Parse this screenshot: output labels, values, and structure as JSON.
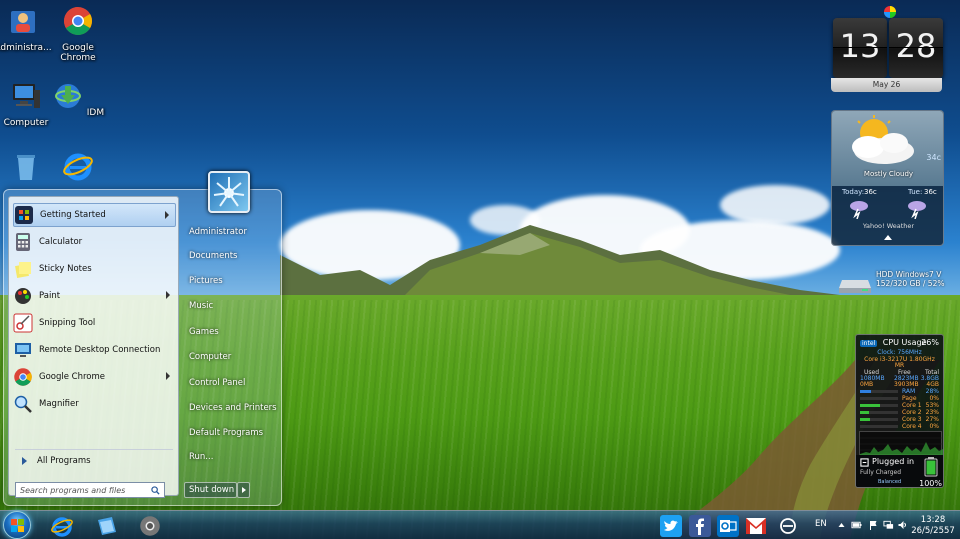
{
  "desktop": {
    "icons": [
      {
        "label": "Administra...",
        "icon": "user-folder-icon"
      },
      {
        "label": "Google Chrome",
        "icon": "chrome-icon"
      },
      {
        "label": "Computer",
        "icon": "computer-icon"
      },
      {
        "label": "IDM",
        "icon": "idm-icon"
      },
      {
        "label": "",
        "icon": "recycle-bin-icon"
      },
      {
        "label": "",
        "icon": "internet-explorer-icon"
      }
    ]
  },
  "start_menu": {
    "programs": [
      {
        "label": "Getting Started",
        "has_submenu": true
      },
      {
        "label": "Calculator",
        "has_submenu": false
      },
      {
        "label": "Sticky Notes",
        "has_submenu": false
      },
      {
        "label": "Paint",
        "has_submenu": true
      },
      {
        "label": "Snipping Tool",
        "has_submenu": false
      },
      {
        "label": "Remote Desktop Connection",
        "has_submenu": false
      },
      {
        "label": "Google Chrome",
        "has_submenu": true
      },
      {
        "label": "Magnifier",
        "has_submenu": false
      }
    ],
    "all_programs": "All Programs",
    "search_placeholder": "Search programs and files",
    "right_items": [
      "Administrator",
      "Documents",
      "Pictures",
      "Music",
      "Games",
      "Computer",
      "Control Panel",
      "Devices and Printers",
      "Default Programs",
      "Run..."
    ],
    "shutdown_label": "Shut down"
  },
  "clock": {
    "hours": "13",
    "minutes": "28",
    "date": "May 26"
  },
  "weather": {
    "current_temp": "34c",
    "condition": "Mostly Cloudy",
    "forecast": [
      {
        "day": "Today:",
        "temp": "36c"
      },
      {
        "day": "Tue:",
        "temp": "36c"
      }
    ],
    "provider": "Yahoo! Weather"
  },
  "drive": {
    "line1": "HDD Windows7 V",
    "line2": "152/320 GB / 52%"
  },
  "cpu": {
    "title": "CPU Usage",
    "usage": "26%",
    "clock": "Clock: 756MHz",
    "model": "Core i3-3217U 1.80GHz",
    "model2": "MR",
    "headers": [
      "Used",
      "Free",
      "Total"
    ],
    "ram_used": "1080MB",
    "ram_free": "2823MB",
    "ram_total": "3.8GB",
    "page_used": "0MB",
    "page_free": "3903MB",
    "page_total": "4GB",
    "rows": [
      {
        "name": "RAM",
        "value": "28%",
        "fraction": 0.28
      },
      {
        "name": "Page",
        "value": "0%",
        "fraction": 0.0
      },
      {
        "name": "Core 1",
        "value": "53%",
        "fraction": 0.53
      },
      {
        "name": "Core 2",
        "value": "23%",
        "fraction": 0.23
      },
      {
        "name": "Core 3",
        "value": "27%",
        "fraction": 0.27
      },
      {
        "name": "Core 4",
        "value": "0%",
        "fraction": 0.0
      }
    ],
    "battery_status": "Plugged in",
    "battery_sub": "Fully Charged",
    "battery_percent": "100%",
    "battery_plan": "Balanced"
  },
  "taskbar": {
    "pinned": [
      "internet-explorer-icon",
      "explorer-window-icon",
      "chrome-icon"
    ],
    "tray_apps": [
      "twitter-icon",
      "facebook-icon",
      "outlook-icon",
      "gmail-icon",
      "sync-icon"
    ],
    "language": "EN",
    "time": "13:28",
    "date": "26/5/2557"
  },
  "colors": {
    "accent": "#1a6fc2",
    "twitter": "#1da1f2",
    "facebook": "#3b5998",
    "outlook": "#0072c6",
    "gmail": "#d93025"
  }
}
